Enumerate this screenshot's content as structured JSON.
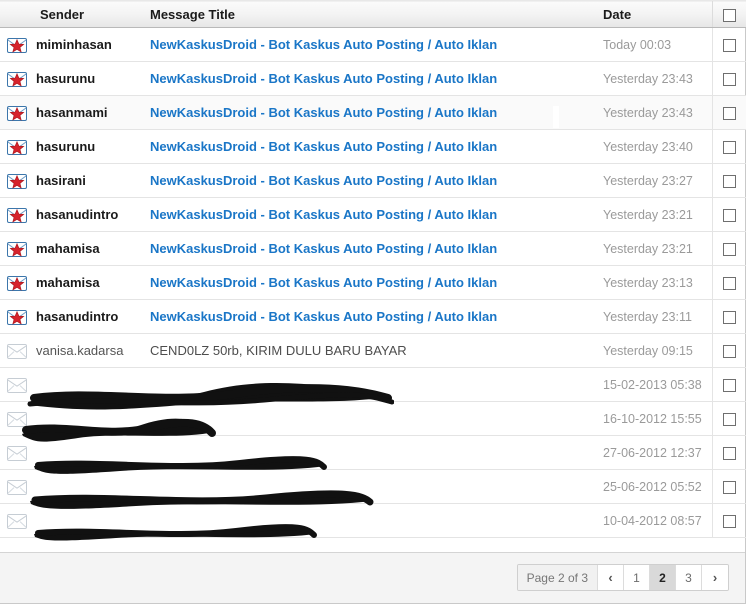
{
  "table": {
    "columns": {
      "icon": "",
      "sender": "Sender",
      "title": "Message Title",
      "date": "Date",
      "select_all": "select-all-checkbox"
    },
    "rows": [
      {
        "icon": "envelope-new-star-icon",
        "sender": "miminhasan",
        "title": "NewKaskusDroid - Bot Kaskus Auto Posting / Auto Iklan",
        "date": "Today 00:03",
        "unread": true,
        "redacted": false
      },
      {
        "icon": "envelope-new-star-icon",
        "sender": "hasurunu",
        "title": "NewKaskusDroid - Bot Kaskus Auto Posting / Auto Iklan",
        "date": "Yesterday 23:43",
        "unread": true,
        "redacted": false
      },
      {
        "icon": "envelope-new-star-icon",
        "sender": "hasanmami",
        "title": "NewKaskusDroid - Bot Kaskus Auto Posting / Auto Iklan",
        "date": "Yesterday 23:43",
        "unread": true,
        "redacted": false
      },
      {
        "icon": "envelope-new-star-icon",
        "sender": "hasurunu",
        "title": "NewKaskusDroid - Bot Kaskus Auto Posting / Auto Iklan",
        "date": "Yesterday 23:40",
        "unread": true,
        "redacted": false
      },
      {
        "icon": "envelope-new-star-icon",
        "sender": "hasirani",
        "title": "NewKaskusDroid - Bot Kaskus Auto Posting / Auto Iklan",
        "date": "Yesterday 23:27",
        "unread": true,
        "redacted": false
      },
      {
        "icon": "envelope-new-star-icon",
        "sender": "hasanudintro",
        "title": "NewKaskusDroid - Bot Kaskus Auto Posting / Auto Iklan",
        "date": "Yesterday 23:21",
        "unread": true,
        "redacted": false
      },
      {
        "icon": "envelope-new-star-icon",
        "sender": "mahamisa",
        "title": "NewKaskusDroid - Bot Kaskus Auto Posting / Auto Iklan",
        "date": "Yesterday 23:21",
        "unread": true,
        "redacted": false
      },
      {
        "icon": "envelope-new-star-icon",
        "sender": "mahamisa",
        "title": "NewKaskusDroid - Bot Kaskus Auto Posting / Auto Iklan",
        "date": "Yesterday 23:13",
        "unread": true,
        "redacted": false
      },
      {
        "icon": "envelope-new-star-icon",
        "sender": "hasanudintro",
        "title": "NewKaskusDroid - Bot Kaskus Auto Posting / Auto Iklan",
        "date": "Yesterday 23:11",
        "unread": true,
        "redacted": false
      },
      {
        "icon": "envelope-read-icon",
        "sender": "vanisa.kadarsa",
        "title": "CEND0LZ 50rb, KIRIM DULU BARU BAYAR",
        "date": "Yesterday 09:15",
        "unread": false,
        "redacted": false
      },
      {
        "icon": "envelope-read-icon",
        "sender": "",
        "title": "",
        "date": "15-02-2013 05:38",
        "unread": false,
        "redacted": true
      },
      {
        "icon": "envelope-read-icon",
        "sender": "",
        "title": "",
        "date": "16-10-2012 15:55",
        "unread": false,
        "redacted": true
      },
      {
        "icon": "envelope-read-icon",
        "sender": "",
        "title": "",
        "date": "27-06-2012 12:37",
        "unread": false,
        "redacted": true
      },
      {
        "icon": "envelope-read-icon",
        "sender": "",
        "title": "",
        "date": "25-06-2012 05:52",
        "unread": false,
        "redacted": true
      },
      {
        "icon": "envelope-read-icon",
        "sender": "",
        "title": "",
        "date": "10-04-2012 08:57",
        "unread": false,
        "redacted": true
      }
    ]
  },
  "pagination": {
    "page_label": "Page 2 of 3",
    "prev": "‹",
    "next": "›",
    "pages": [
      "1",
      "2",
      "3"
    ],
    "current": "2"
  },
  "colors": {
    "link": "#1a76c7",
    "star": "#d6232c",
    "envelope_new": "#3c76ab",
    "envelope_read": "#c6cdd4",
    "date_text": "#9a9a9a",
    "header_text": "#1b1b1b",
    "footer_bg": "#f4f4f4",
    "active_page_bg": "#d9d9d9"
  }
}
